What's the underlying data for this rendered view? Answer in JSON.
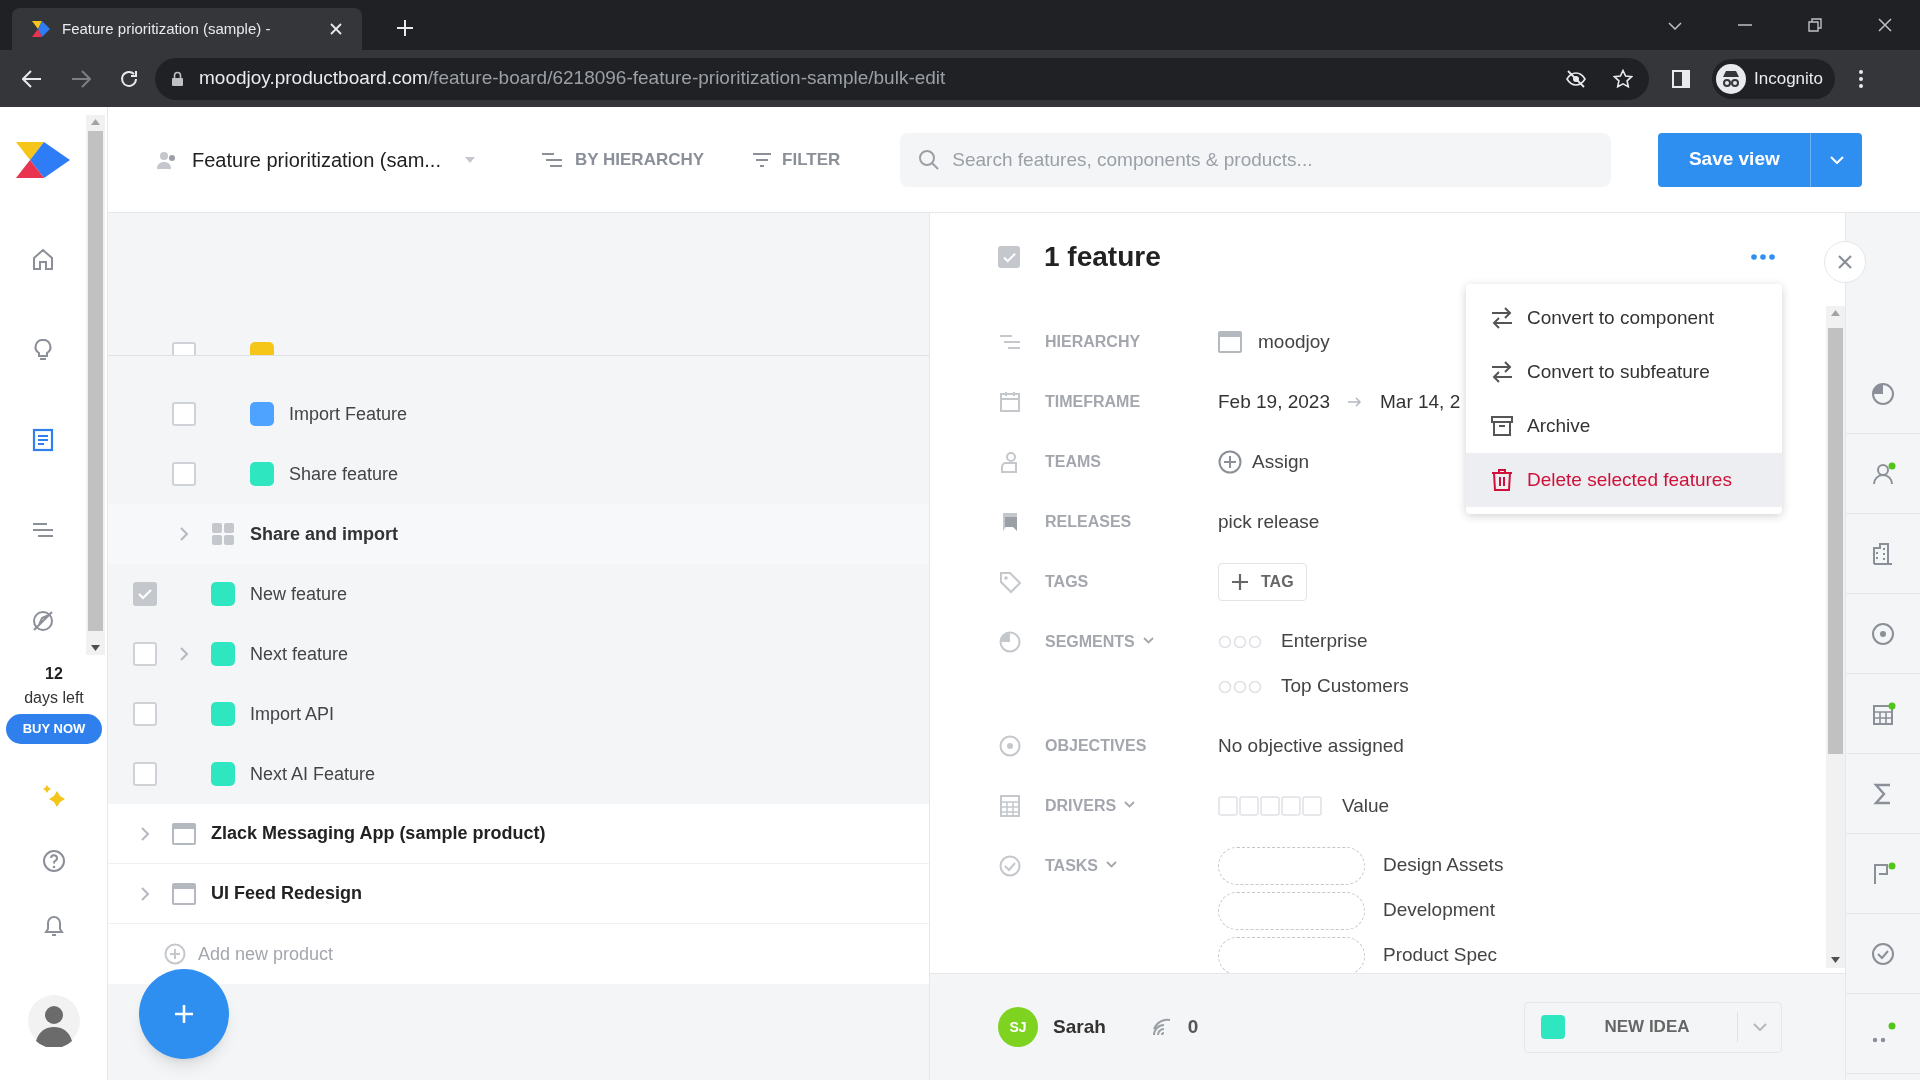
{
  "browser": {
    "tab_title": "Feature prioritization (sample) - ",
    "url_host": "moodjoy.productboard.com",
    "url_path": "/feature-board/6218096-feature-prioritization-sample/bulk-edit",
    "profile": "Incognito"
  },
  "nav": {
    "items": [
      {
        "selected": false
      },
      {
        "selected": false
      },
      {
        "selected": true
      },
      {
        "selected": false
      },
      {
        "selected": false
      }
    ],
    "trial_days": "12",
    "trial_label": "days left",
    "buy_button": "BUY NOW"
  },
  "toolbar": {
    "board": "Feature prioritization (sam...",
    "grouping": "BY HIERARCHY",
    "filter": "FILTER",
    "search_placeholder": "Search features, components & products...",
    "save": "Save view"
  },
  "tree": [
    {
      "children": [
        {
          "children": [
            {
              "kind": "feature",
              "color": "#f5c518",
              "checked": false
            },
            {
              "kind": "feature",
              "label": "Import Feature",
              "color": "#4da3ff",
              "checked": false
            },
            {
              "kind": "feature",
              "label": "Share feature",
              "color": "#2ee6c0",
              "checked": false
            }
          ]
        },
        {
          "kind": "component",
          "label": "Share and import",
          "expanded": false
        },
        {
          "kind": "feature",
          "label": "New feature",
          "color": "#2ee6c0",
          "checked": true
        },
        {
          "kind": "feature",
          "label": "Next feature",
          "color": "#2ee6c0",
          "checked": false,
          "expanded": false
        },
        {
          "kind": "feature",
          "label": "Import API",
          "color": "#2ee6c0",
          "checked": false
        },
        {
          "kind": "feature",
          "label": "Next AI Feature",
          "color": "#2ee6c0",
          "checked": false
        }
      ]
    },
    {
      "kind": "product",
      "label": "Zlack Messaging App (sample product)",
      "expanded": false
    },
    {
      "kind": "product",
      "label": "UI Feed Redesign",
      "expanded": false
    }
  ],
  "add_product": "Add new product",
  "detail": {
    "title": "1 feature",
    "all_checked": true,
    "properties": [
      {
        "kind": "hierarchy",
        "label": "HIERARCHY",
        "value": "moodjoy"
      },
      {
        "kind": "timeframe",
        "label": "TIMEFRAME",
        "start": "Feb 19, 2023",
        "end": "Mar 14, 2"
      },
      {
        "kind": "teams",
        "label": "TEAMS",
        "action": "Assign"
      },
      {
        "kind": "releases",
        "label": "RELEASES",
        "value": "pick release"
      },
      {
        "kind": "tags",
        "label": "TAGS",
        "action": "TAG"
      },
      {
        "kind": "segments",
        "label": "SEGMENTS",
        "items": [
          "Enterprise",
          "Top Customers"
        ]
      },
      {
        "kind": "objectives",
        "label": "OBJECTIVES",
        "value": "No objective assigned"
      },
      {
        "kind": "drivers",
        "label": "DRIVERS",
        "items": [
          "Value"
        ]
      },
      {
        "kind": "tasks",
        "label": "TASKS",
        "items": [
          "Design Assets",
          "Development",
          "Product Spec"
        ]
      }
    ]
  },
  "menu": [
    {
      "kind": "convert",
      "label": "Convert to component",
      "selected": false
    },
    {
      "kind": "convert",
      "label": "Convert to subfeature",
      "selected": false
    },
    {
      "kind": "archive",
      "label": "Archive",
      "selected": false
    },
    {
      "kind": "delete",
      "label": "Delete selected features",
      "selected": true
    }
  ],
  "rail": [
    {
      "badge": false
    },
    {
      "badge": true
    },
    {
      "badge": false
    },
    {
      "badge": false
    },
    {
      "badge": true
    },
    {
      "badge": false
    },
    {
      "badge": true
    },
    {
      "badge": false
    },
    {
      "badge": true
    }
  ],
  "footer": {
    "initials": "SJ",
    "user": "Sarah",
    "count": "0",
    "status": {
      "label": "NEW IDEA",
      "color": "#2ee6c0"
    }
  }
}
